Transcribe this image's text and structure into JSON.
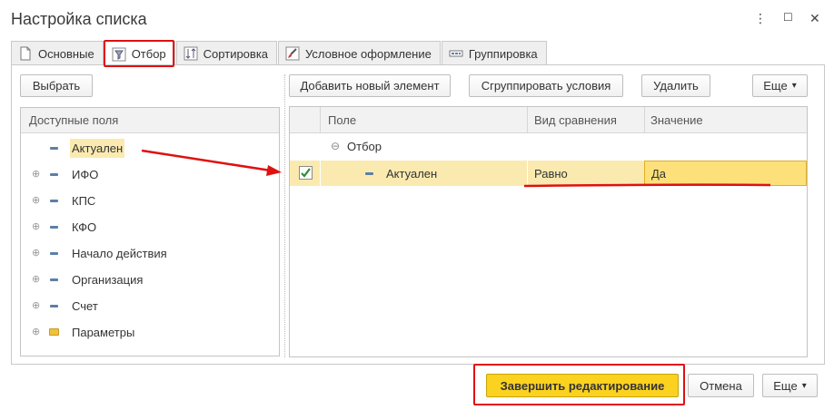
{
  "window": {
    "title": "Настройка списка",
    "menu_icon": "⋮",
    "maximize_icon": "☐",
    "close_icon": "✕"
  },
  "tabs": [
    {
      "label": "Основные",
      "icon": "page-icon"
    },
    {
      "label": "Отбор",
      "icon": "filter-icon"
    },
    {
      "label": "Сортировка",
      "icon": "sort-icon"
    },
    {
      "label": "Условное оформление",
      "icon": "brush-icon"
    },
    {
      "label": "Группировка",
      "icon": "group-icon"
    }
  ],
  "left": {
    "choose_button": "Выбрать",
    "header": "Доступные поля",
    "items": [
      {
        "label": "Актуален",
        "expandable": false,
        "icon": "field-icon",
        "selected": true
      },
      {
        "label": "ИФО",
        "expandable": true,
        "icon": "field-icon"
      },
      {
        "label": "КПС",
        "expandable": true,
        "icon": "field-icon"
      },
      {
        "label": "КФО",
        "expandable": true,
        "icon": "field-icon"
      },
      {
        "label": "Начало действия",
        "expandable": true,
        "icon": "field-icon"
      },
      {
        "label": "Организация",
        "expandable": true,
        "icon": "field-icon"
      },
      {
        "label": "Счет",
        "expandable": true,
        "icon": "field-icon"
      },
      {
        "label": "Параметры",
        "expandable": true,
        "icon": "folder-icon"
      }
    ]
  },
  "right": {
    "toolbar": {
      "add": "Добавить новый элемент",
      "group": "Сгруппировать условия",
      "delete": "Удалить",
      "more": "Еще",
      "more_arrow": "▾"
    },
    "columns": [
      "Поле",
      "Вид сравнения",
      "Значение"
    ],
    "root_label": "Отбор",
    "root_toggle": "⊖",
    "rows": [
      {
        "checked": true,
        "field": "Актуален",
        "comparison": "Равно",
        "value": "Да"
      }
    ]
  },
  "footer": {
    "finish": "Завершить редактирование",
    "cancel": "Отмена",
    "more": "Еще",
    "more_arrow": "▾"
  },
  "colors": {
    "accent_yellow": "#fad21f",
    "highlight": "#fbeab0",
    "annotation_red": "#e01010"
  }
}
